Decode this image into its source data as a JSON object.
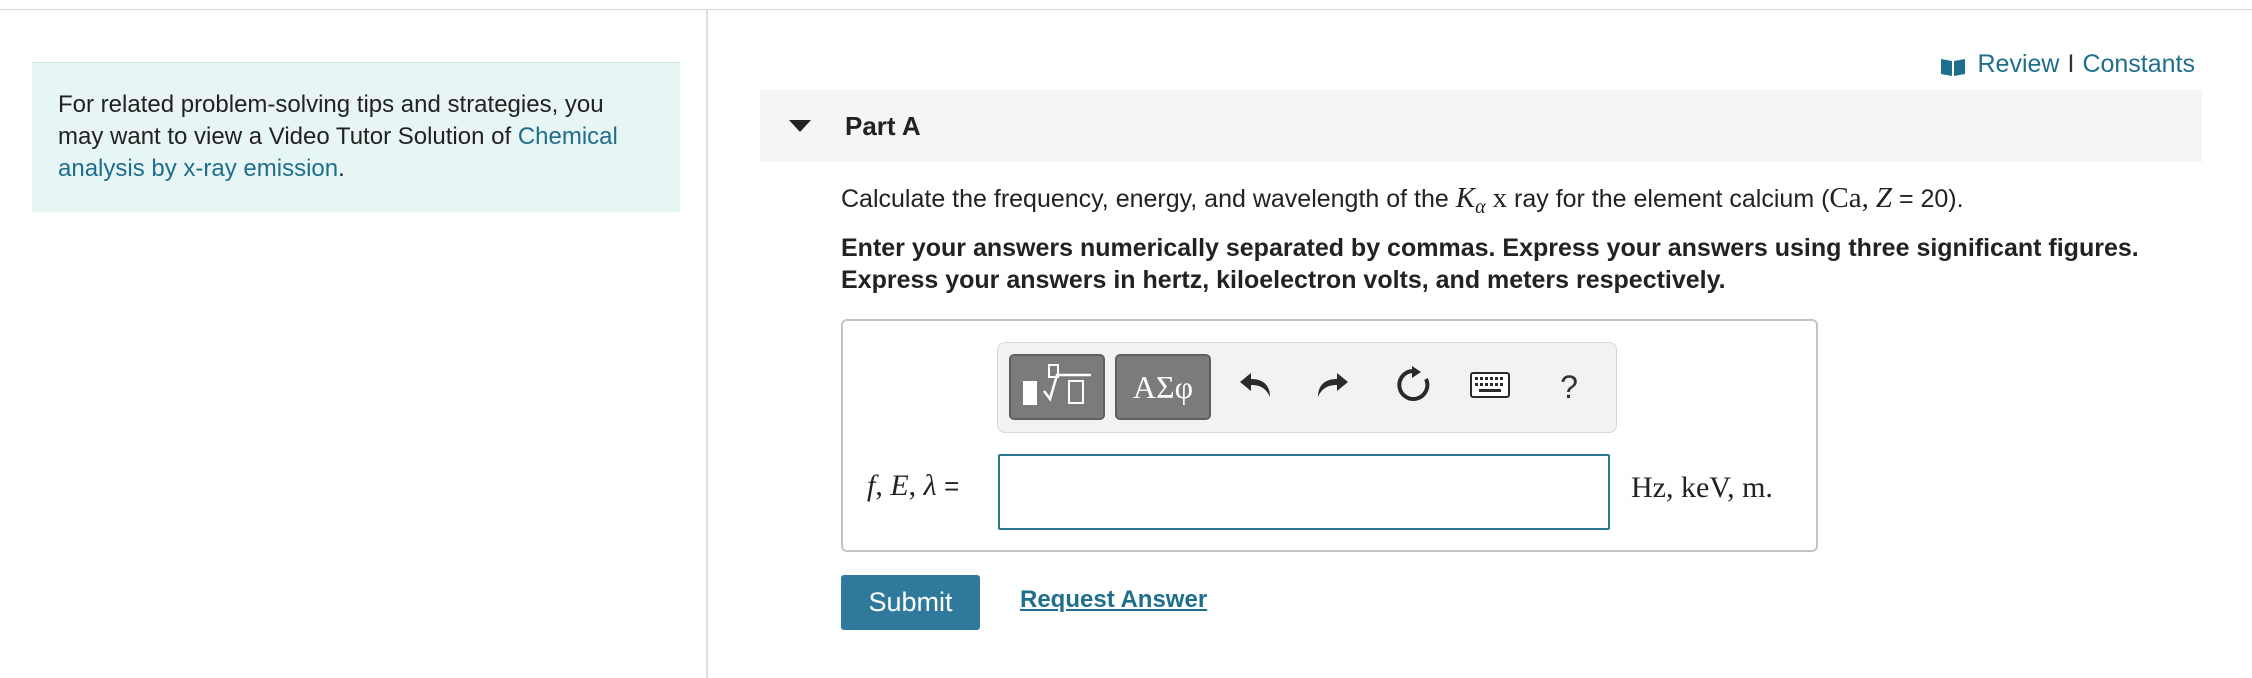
{
  "left_panel": {
    "tip_text": "For related problem-solving tips and strategies, you may want to view a Video Tutor Solution of",
    "tip_link": "Chemical analysis by x-ray emission",
    "tip_end": "."
  },
  "header": {
    "review_label": "Review",
    "separator": "I",
    "constants_label": "Constants",
    "icon": "book-icon"
  },
  "part": {
    "title": "Part A",
    "question_pre": "Calculate the frequency, energy, and wavelength of the",
    "k_symbol": "K",
    "k_sub": "α",
    "x_symbol": "x",
    "question_mid": "ray for the element calcium (",
    "ca_symbol": "Ca",
    "comma": ",",
    "z_symbol": "Z",
    "question_end": "= 20).",
    "instructions_line1": "Enter your answers numerically separated by commas. Express your answers using three significant figures.",
    "instructions_line2": "Express your answers in hertz, kiloelectron volts, and meters respectively."
  },
  "answer": {
    "variable_f": "f",
    "variable_E": "E",
    "variable_lambda": "λ",
    "equals": "=",
    "units": "Hz, keV, m.",
    "input_value": "",
    "toolbar": {
      "greek_label": "ΑΣφ",
      "help_label": "?",
      "icons": [
        "templates-icon",
        "undo-icon",
        "redo-icon",
        "reset-icon",
        "keyboard-icon",
        "help-icon"
      ]
    }
  },
  "actions": {
    "submit_label": "Submit",
    "request_label": "Request Answer"
  },
  "colors": {
    "accent": "#1f6e8c",
    "submit_bg": "#2f7a9c",
    "tip_bg": "#e8f5f5"
  }
}
